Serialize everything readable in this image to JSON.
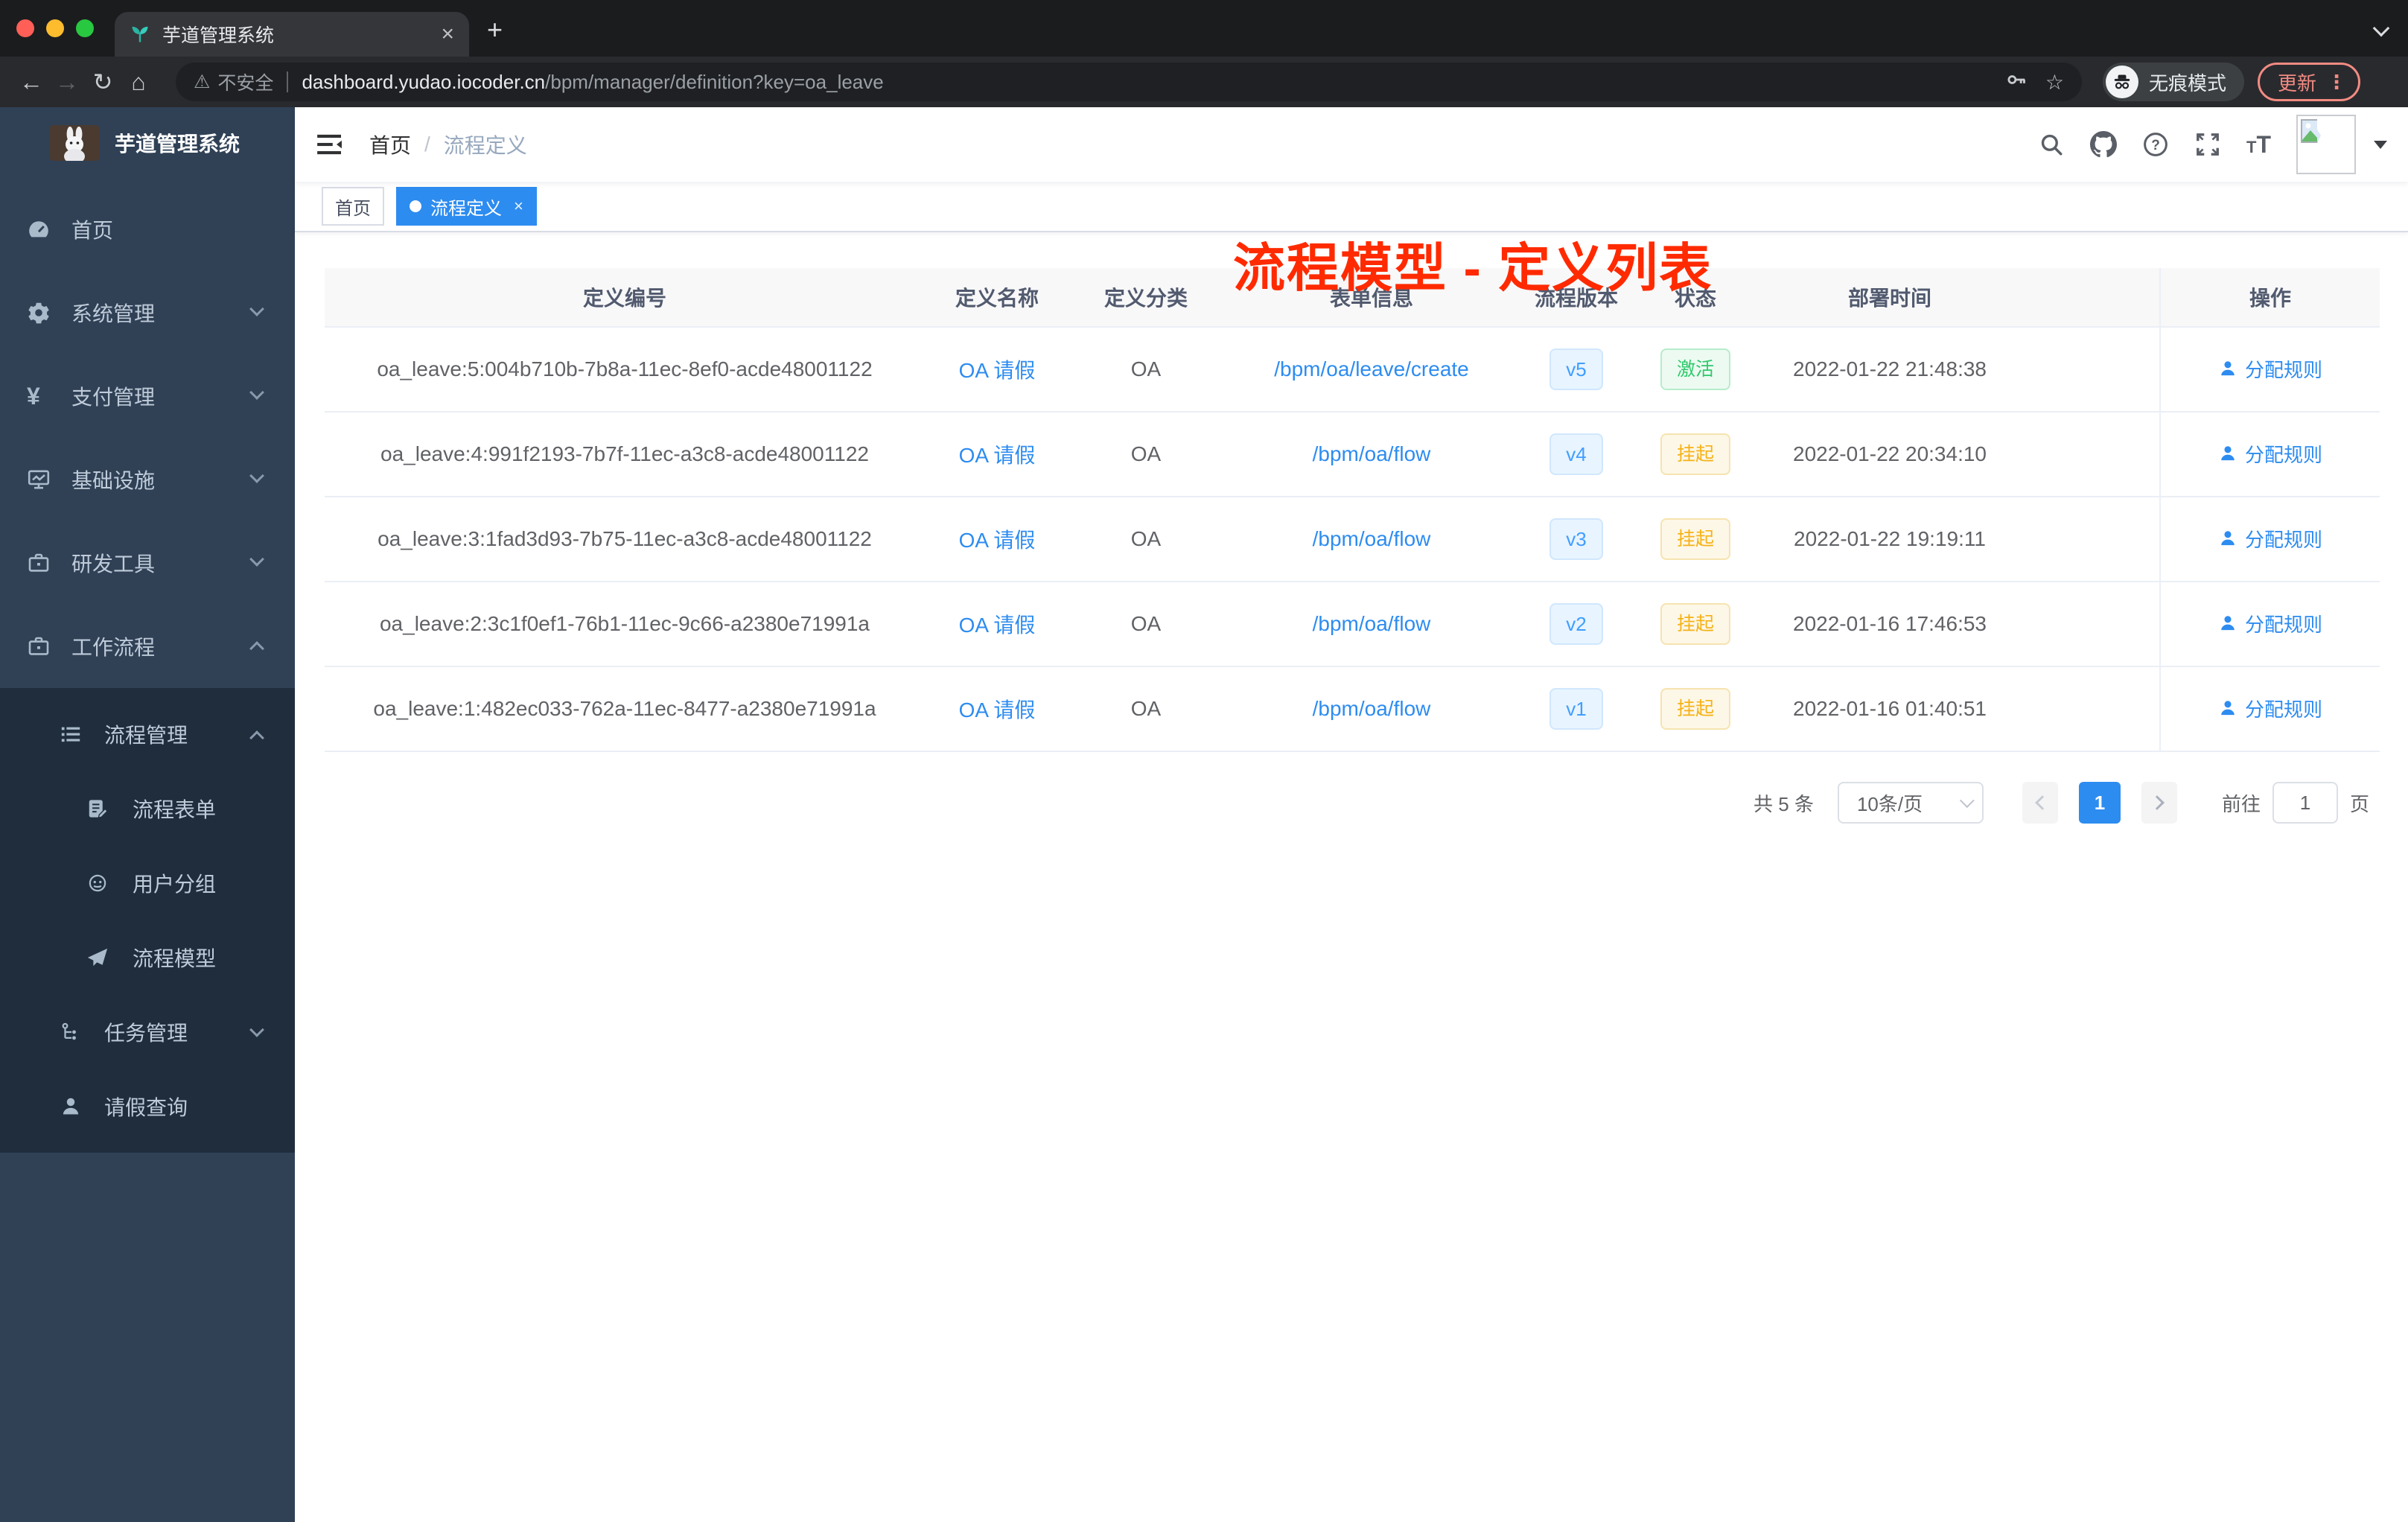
{
  "browser": {
    "tab_title": "芋道管理系统",
    "new_tab": "+",
    "close_tab": "×",
    "security_label": "不安全",
    "url_host": "dashboard.yudao.iocoder.cn",
    "url_path": "/bpm/manager/definition?key=oa_leave",
    "incognito_label": "无痕模式",
    "update_label": "更新",
    "update_dots": "⋮",
    "back": "←",
    "forward": "→",
    "reload": "↻",
    "home": "⌂",
    "warning": "⚠",
    "star": "☆"
  },
  "sidebar": {
    "logo_title": "芋道管理系统",
    "items": [
      {
        "label": "首页"
      },
      {
        "label": "系统管理"
      },
      {
        "label": "支付管理"
      },
      {
        "label": "基础设施"
      },
      {
        "label": "研发工具"
      },
      {
        "label": "工作流程"
      },
      {
        "label": "流程管理"
      },
      {
        "label": "流程表单"
      },
      {
        "label": "用户分组"
      },
      {
        "label": "流程模型"
      },
      {
        "label": "任务管理"
      },
      {
        "label": "请假查询"
      }
    ],
    "yen_glyph": "¥"
  },
  "header": {
    "breadcrumb_home": "首页",
    "breadcrumb_sep": "/",
    "breadcrumb_current": "流程定义",
    "annotation": "流程模型 - 定义列表",
    "font_size_icon": "T"
  },
  "tags": [
    {
      "label": "首页",
      "active": false
    },
    {
      "label": "流程定义",
      "active": true,
      "close": "×"
    }
  ],
  "table": {
    "columns": [
      "定义编号",
      "定义名称",
      "定义分类",
      "表单信息",
      "流程版本",
      "状态",
      "部署时间",
      "操作"
    ],
    "rows": [
      {
        "id": "oa_leave:5:004b710b-7b8a-11ec-8ef0-acde48001122",
        "name": "OA 请假",
        "category": "OA",
        "form": "/bpm/oa/leave/create",
        "version": "v5",
        "status": "激活",
        "status_type": "success",
        "time": "2022-01-22 21:48:38",
        "action": "分配规则"
      },
      {
        "id": "oa_leave:4:991f2193-7b7f-11ec-a3c8-acde48001122",
        "name": "OA 请假",
        "category": "OA",
        "form": "/bpm/oa/flow",
        "version": "v4",
        "status": "挂起",
        "status_type": "warn",
        "time": "2022-01-22 20:34:10",
        "action": "分配规则"
      },
      {
        "id": "oa_leave:3:1fad3d93-7b75-11ec-a3c8-acde48001122",
        "name": "OA 请假",
        "category": "OA",
        "form": "/bpm/oa/flow",
        "version": "v3",
        "status": "挂起",
        "status_type": "warn",
        "time": "2022-01-22 19:19:11",
        "action": "分配规则"
      },
      {
        "id": "oa_leave:2:3c1f0ef1-76b1-11ec-9c66-a2380e71991a",
        "name": "OA 请假",
        "category": "OA",
        "form": "/bpm/oa/flow",
        "version": "v2",
        "status": "挂起",
        "status_type": "warn",
        "time": "2022-01-16 17:46:53",
        "action": "分配规则"
      },
      {
        "id": "oa_leave:1:482ec033-762a-11ec-8477-a2380e71991a",
        "name": "OA 请假",
        "category": "OA",
        "form": "/bpm/oa/flow",
        "version": "v1",
        "status": "挂起",
        "status_type": "warn",
        "time": "2022-01-16 01:40:51",
        "action": "分配规则"
      }
    ]
  },
  "pagination": {
    "total_label": "共 5 条",
    "page_size": "10条/页",
    "current_page": "1",
    "goto_label": "前往",
    "goto_value": "1",
    "page_label": "页"
  },
  "colors": {
    "accent_blue": "#2d8cf0",
    "version_blue": "#409eff",
    "success_green": "#2fc96c",
    "warning_amber": "#f5b217",
    "annotation_red": "#ff2a00",
    "sidebar_bg": "#304156",
    "submenu_bg": "#1f2d3d"
  }
}
